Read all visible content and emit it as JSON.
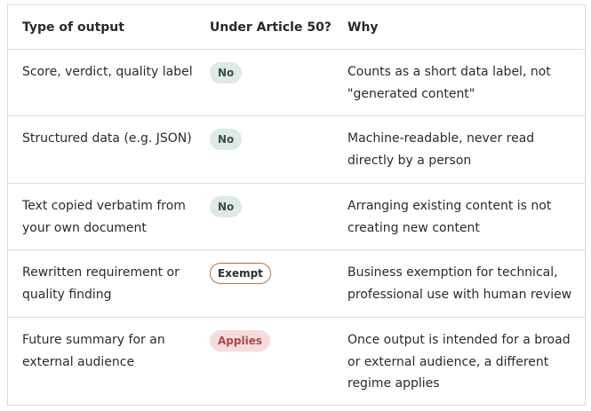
{
  "header": {
    "col_type": "Type of output",
    "col_article": "Under Article 50?",
    "col_why": "Why"
  },
  "rows": [
    {
      "type": "Score, verdict, quality label",
      "status": "No",
      "why": "Counts as a short data label, not \"generated content\""
    },
    {
      "type": "Structured data (e.g. JSON)",
      "status": "No",
      "why": "Machine-readable, never read directly by a person"
    },
    {
      "type": "Text copied verbatim from your own document",
      "status": "No",
      "why": "Arranging existing content is not creating new content"
    },
    {
      "type": "Rewritten requirement or quality finding",
      "status": "Exempt",
      "why": "Business exemption for technical, professional use with human review"
    },
    {
      "type": "Future summary for an external audience",
      "status": "Applies",
      "why": "Once output is intended for a broad or external audience, a different regime applies"
    }
  ],
  "colors": {
    "badge_no_bg": "#dfe9e6",
    "badge_exempt_border": "#b3733a",
    "badge_applies_bg": "#f6dcdc",
    "badge_applies_text": "#a94a4a",
    "border": "#dcdcdc"
  }
}
